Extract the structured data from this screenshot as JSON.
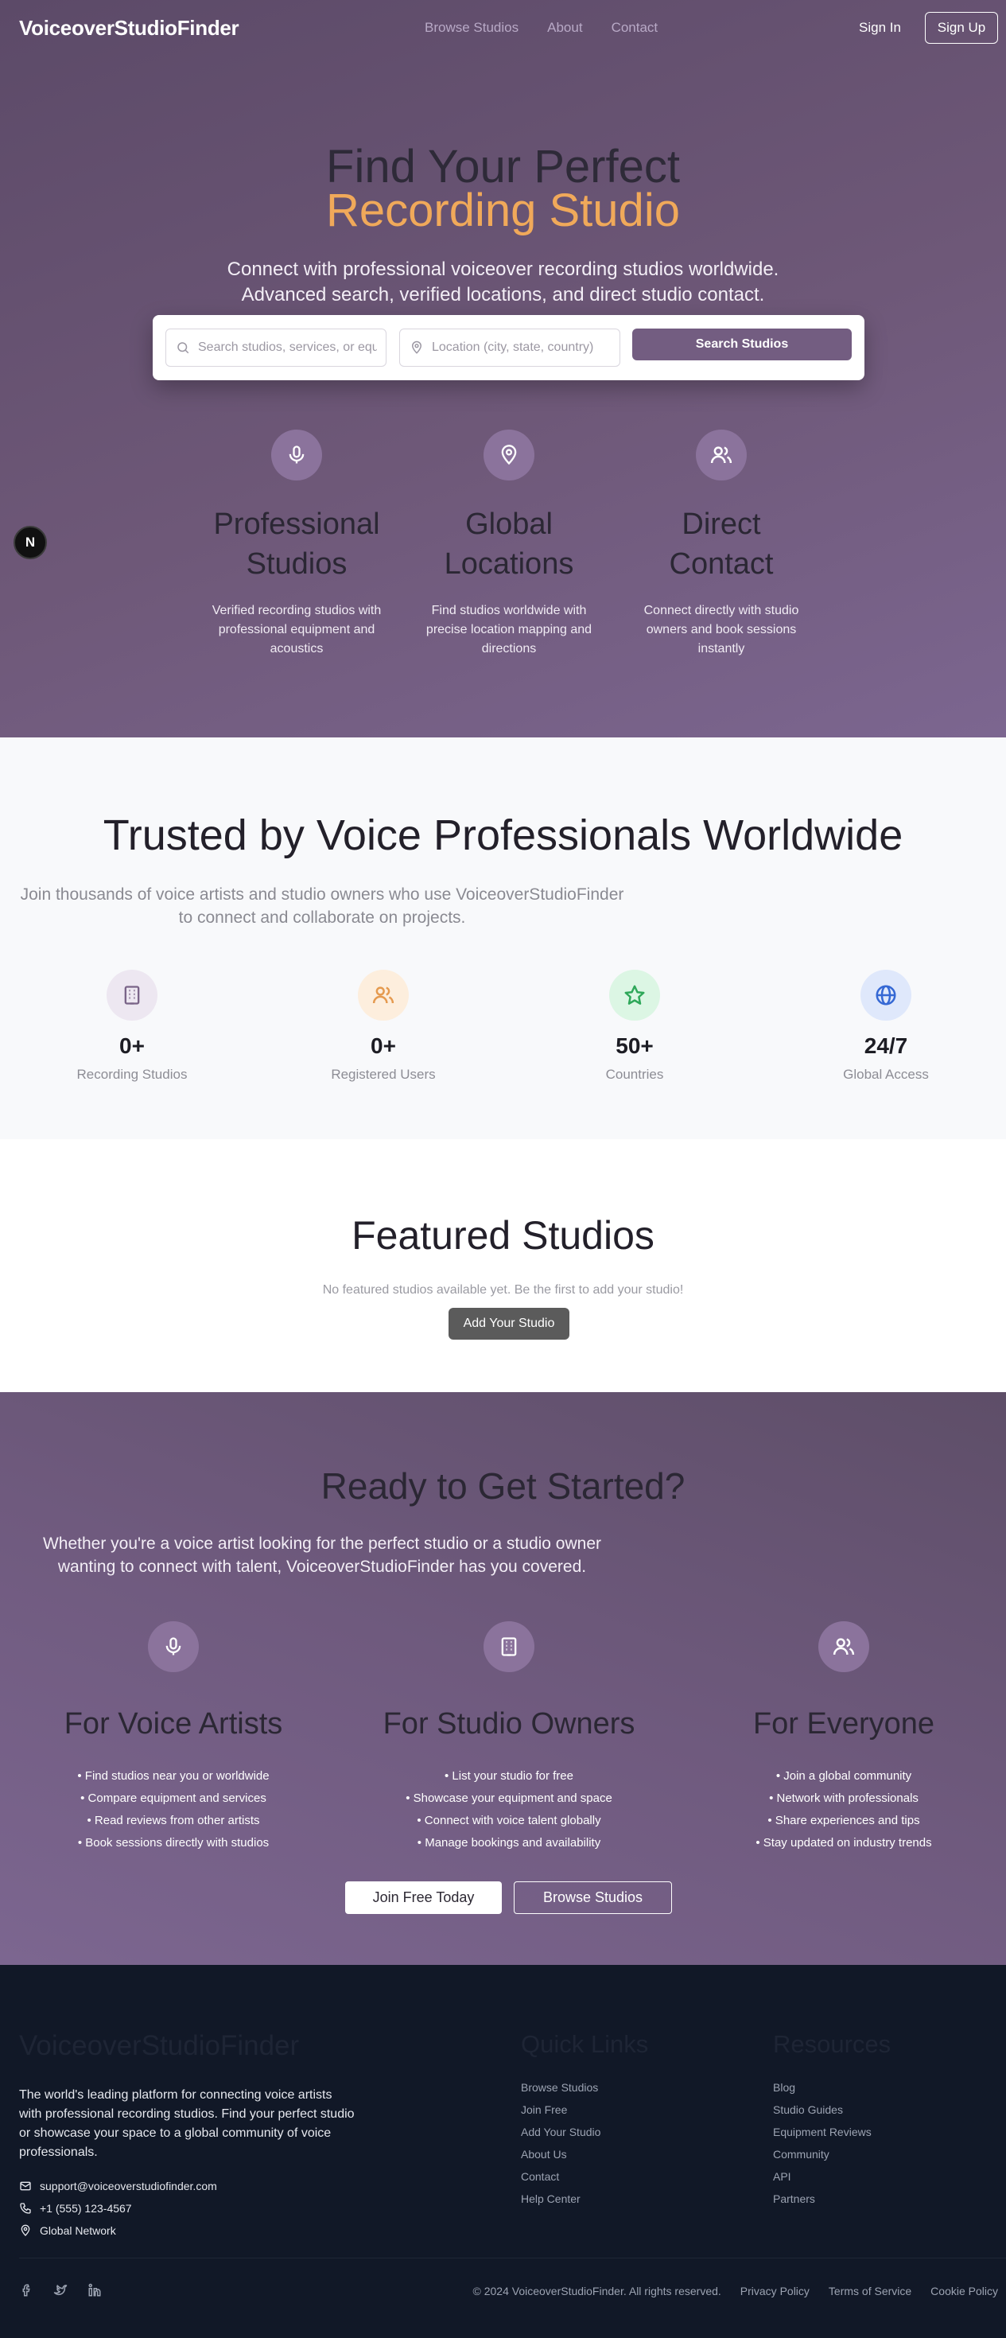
{
  "nav": {
    "logo": "VoiceoverStudioFinder",
    "links": [
      "Browse Studios",
      "About",
      "Contact"
    ],
    "sign_in": "Sign In",
    "sign_up": "Sign Up"
  },
  "hero": {
    "title_line1": "Find Your Perfect",
    "title_line2": "Recording Studio",
    "subtitle_line1": "Connect with professional voiceover recording studios worldwide.",
    "subtitle_line2": "Advanced search, verified locations, and direct studio contact.",
    "search": {
      "keyword_placeholder": "Search studios, services, or equipment...",
      "location_placeholder": "Location (city, state, country)",
      "button": "Search Studios"
    },
    "features": [
      {
        "icon": "microphone-icon",
        "title_line1": "Professional",
        "title_line2": "Studios",
        "desc_line1": "Verified recording studios with",
        "desc_line2": "professional equipment and",
        "desc_line3": "acoustics"
      },
      {
        "icon": "map-pin-icon",
        "title_line1": "Global",
        "title_line2": "Locations",
        "desc_line1": "Find studios worldwide with",
        "desc_line2": "precise location mapping and",
        "desc_line3": "directions"
      },
      {
        "icon": "users-icon",
        "title_line1": "Direct",
        "title_line2": "Contact",
        "desc_line1": "Connect directly with studio",
        "desc_line2": "owners and book sessions",
        "desc_line3": "instantly"
      }
    ],
    "dev_badge": "N"
  },
  "trusted": {
    "title": "Trusted by Voice Professionals Worldwide",
    "lead_line1": "Join thousands of voice artists and studio owners who use VoiceoverStudioFinder",
    "lead_line2": "to connect and collaborate on projects.",
    "stats": [
      {
        "icon": "building-icon",
        "value": "0+",
        "label": "Recording Studios",
        "bg": "#ede7f1",
        "fg": "#7a6488"
      },
      {
        "icon": "users-icon",
        "value": "0+",
        "label": "Registered Users",
        "bg": "#fdeedd",
        "fg": "#e59a4f"
      },
      {
        "icon": "star-icon",
        "value": "50+",
        "label": "Countries",
        "bg": "#dcf6e4",
        "fg": "#2fa85a"
      },
      {
        "icon": "globe-icon",
        "value": "24/7",
        "label": "Global Access",
        "bg": "#dfe8fb",
        "fg": "#3568d4"
      }
    ]
  },
  "featured": {
    "title": "Featured Studios",
    "empty_text": "No featured studios available yet. Be the first to add your studio!",
    "add_button": "Add Your Studio"
  },
  "cta": {
    "title": "Ready to Get Started?",
    "lead_line1": "Whether you're a voice artist looking for the perfect studio or a studio owner",
    "lead_line2": "wanting to connect with talent, VoiceoverStudioFinder has you covered.",
    "audiences": [
      {
        "icon": "microphone-icon",
        "title": "For Voice Artists",
        "items": [
          "• Find studios near you or worldwide",
          "• Compare equipment and services",
          "• Read reviews from other artists",
          "• Book sessions directly with studios"
        ]
      },
      {
        "icon": "building-icon",
        "title": "For Studio Owners",
        "items": [
          "• List your studio for free",
          "• Showcase your equipment and space",
          "• Connect with voice talent globally",
          "• Manage bookings and availability"
        ]
      },
      {
        "icon": "users-icon",
        "title": "For Everyone",
        "items": [
          "• Join a global community",
          "• Network with professionals",
          "• Share experiences and tips",
          "• Stay updated on industry trends"
        ]
      }
    ],
    "join_button": "Join Free Today",
    "browse_button": "Browse Studios"
  },
  "footer": {
    "brand": "VoiceoverStudioFinder",
    "desc_line1": "The world's leading platform for connecting voice artists",
    "desc_line2": "with professional recording studios. Find your perfect studio",
    "desc_line3": "or showcase your space to a global community of voice",
    "desc_line4": "professionals.",
    "email": "support@voiceoverstudiofinder.com",
    "phone": "+1 (555) 123-4567",
    "network": "Global Network",
    "quick_links_title": "Quick Links",
    "quick_links": [
      "Browse Studios",
      "Join Free",
      "Add Your Studio",
      "About Us",
      "Contact",
      "Help Center"
    ],
    "resources_title": "Resources",
    "resources": [
      "Blog",
      "Studio Guides",
      "Equipment Reviews",
      "Community",
      "API",
      "Partners"
    ],
    "copyright": "© 2024 VoiceoverStudioFinder. All rights reserved.",
    "legal": [
      "Privacy Policy",
      "Terms of Service",
      "Cookie Policy"
    ]
  }
}
